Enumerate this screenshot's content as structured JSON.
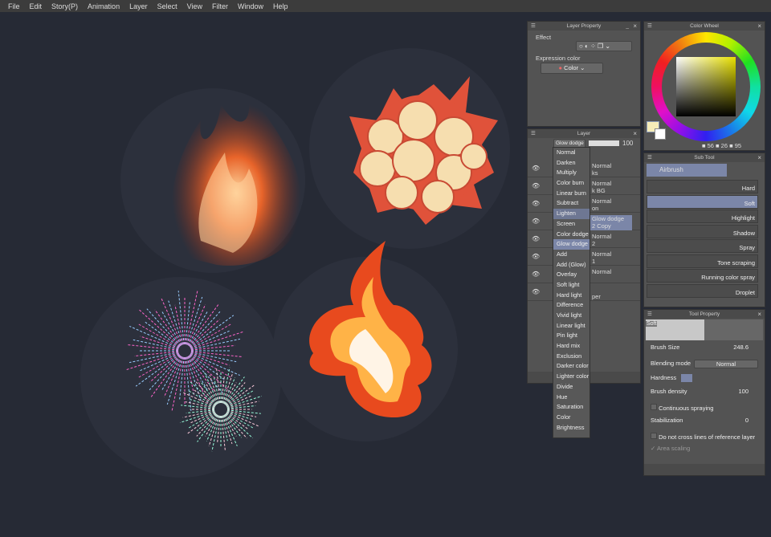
{
  "menu": [
    "File",
    "Edit",
    "Story(P)",
    "Animation",
    "Layer",
    "Select",
    "View",
    "Filter",
    "Window",
    "Help"
  ],
  "layer_property": {
    "title": "Layer Property",
    "effect_label": "Effect",
    "expression_label": "Expression color",
    "expression_value": "Color"
  },
  "layer_panel": {
    "title": "Layer",
    "blend_value": "Glow dodge",
    "opacity": "100",
    "layers": [
      {
        "mode": "Normal",
        "name": "ks"
      },
      {
        "mode": "Normal",
        "name": "k BG"
      },
      {
        "mode": "Normal",
        "name": "on"
      },
      {
        "mode": "Glow dodge",
        "name": "2 Copy"
      },
      {
        "mode": "Normal",
        "name": "2"
      },
      {
        "mode": "Normal",
        "name": "1"
      },
      {
        "mode": "Normal",
        "name": ""
      },
      {
        "mode": "",
        "name": "per"
      }
    ]
  },
  "blend_menu": {
    "items": [
      "Normal",
      "Darken",
      "Multiply",
      "Color burn",
      "Linear burn",
      "Subtract",
      "Lighten",
      "Screen",
      "Color dodge",
      "Glow dodge",
      "Add",
      "Add (Glow)",
      "Overlay",
      "Soft light",
      "Hard light",
      "Difference",
      "Vivid light",
      "Linear light",
      "Pin light",
      "Hard mix",
      "Exclusion",
      "Darker color",
      "Lighter color",
      "Divide",
      "Hue",
      "Saturation",
      "Color",
      "Brightness"
    ],
    "selected": "Glow dodge",
    "hovered": "Lighten"
  },
  "color_wheel": {
    "title": "Color Wheel",
    "h": "56",
    "s": "26",
    "v": "95",
    "main_color": "#f5ecb8",
    "sub_color": "#ffffff"
  },
  "sub_tool": {
    "title": "Sub Tool",
    "group": "Airbrush",
    "items": [
      "Hard",
      "Soft",
      "Highlight",
      "Shadow",
      "Spray",
      "Tone scraping",
      "Running color spray",
      "Droplet"
    ],
    "selected": "Soft"
  },
  "tool_property": {
    "title": "Tool Property",
    "preset": "Soft",
    "brush_size_label": "Brush Size",
    "brush_size": "248.6",
    "blending_label": "Blending mode",
    "blending_value": "Normal",
    "hardness_label": "Hardness",
    "density_label": "Brush density",
    "density": "100",
    "continuous_label": "Continuous spraying",
    "stabilization_label": "Stabilization",
    "stabilization": "0",
    "no_cross_label": "Do not cross lines of reference layer",
    "area_scaling_label": "Area scaling"
  }
}
